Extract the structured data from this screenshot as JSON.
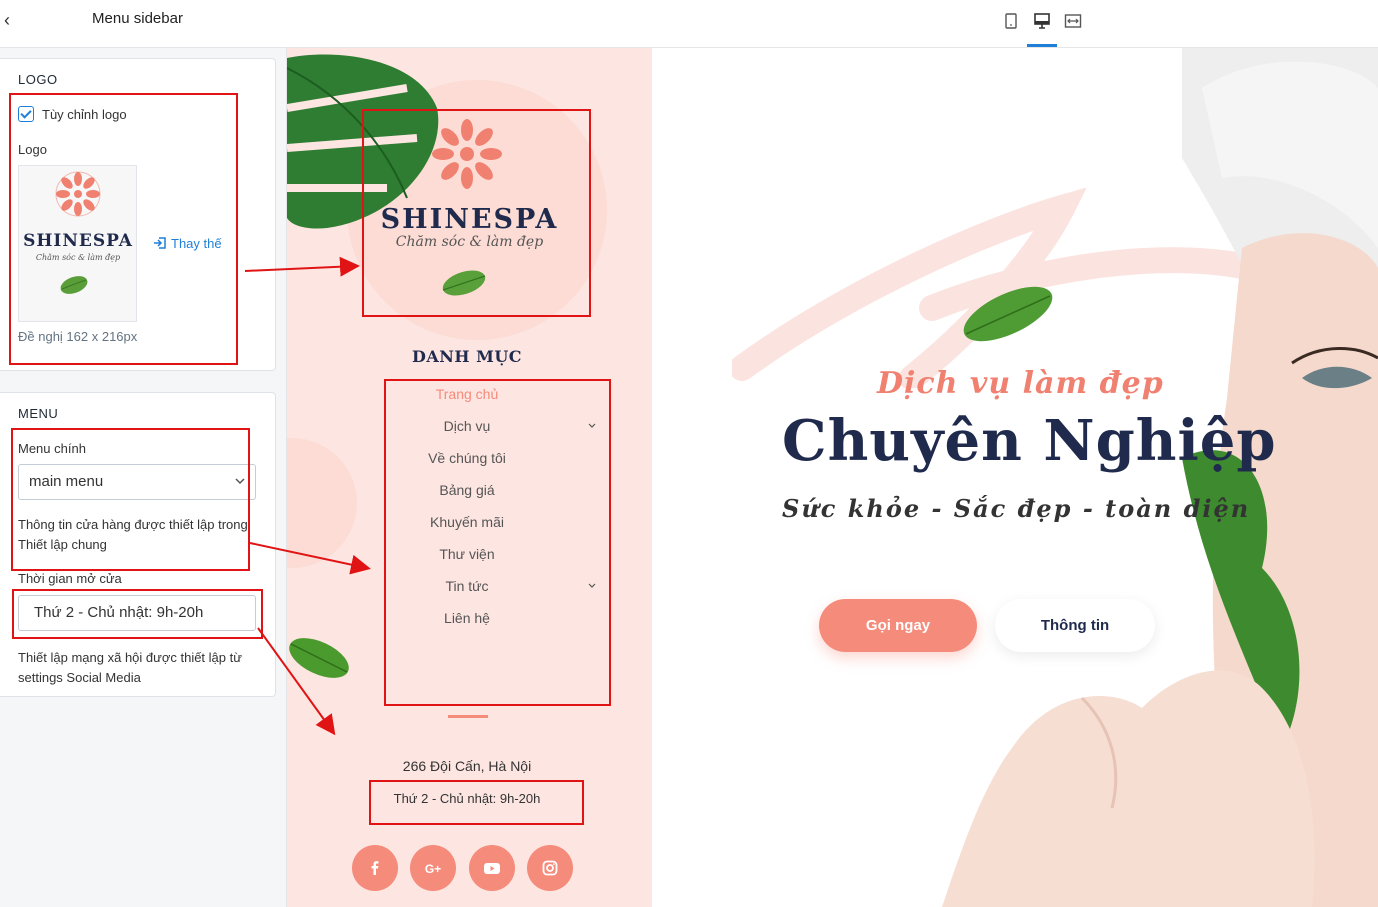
{
  "panel": {
    "title": "Menu sidebar",
    "logo_section": {
      "title": "LOGO",
      "custom_logo_label": "Tùy chỉnh logo",
      "custom_logo_checked": true,
      "logo_label": "Logo",
      "replace_label": "Thay thế",
      "size_hint": "Đề nghị 162 x 216px"
    },
    "menu_section": {
      "title": "MENU",
      "main_menu_label": "Menu chính",
      "main_menu_value": "main menu",
      "store_info_text": "Thông tin cửa hàng được thiết lập trong Thiết lập chung",
      "opening_hours_label": "Thời gian mở cửa",
      "opening_hours_value": "Thứ 2 - Chủ nhật: 9h-20h",
      "social_info_text": "Thiết lập mạng xã hội được thiết lập từ settings Social Media"
    }
  },
  "toolbar": {
    "icons": [
      "mobile-icon",
      "desktop-icon",
      "fullwidth-icon"
    ],
    "active": "desktop-icon"
  },
  "logo": {
    "brand": "SHINESPA",
    "tagline": "Chăm sóc & làm đẹp"
  },
  "preview_sidebar": {
    "heading": "DANH MỤC",
    "nav": [
      {
        "label": "Trang chủ",
        "active": true,
        "has_children": false
      },
      {
        "label": "Dịch vụ",
        "active": false,
        "has_children": true
      },
      {
        "label": "Về chúng tôi",
        "active": false,
        "has_children": false
      },
      {
        "label": "Bảng giá",
        "active": false,
        "has_children": false
      },
      {
        "label": "Khuyến mãi",
        "active": false,
        "has_children": false
      },
      {
        "label": "Thư viện",
        "active": false,
        "has_children": false
      },
      {
        "label": "Tin tức",
        "active": false,
        "has_children": true
      },
      {
        "label": "Liên hệ",
        "active": false,
        "has_children": false
      }
    ],
    "address": "266 Đội Cấn, Hà Nội",
    "hours": "Thứ 2 - Chủ nhật: 9h-20h",
    "social": [
      "facebook-icon",
      "google-plus-icon",
      "youtube-icon",
      "instagram-icon"
    ]
  },
  "hero": {
    "script_title": "Dịch vụ làm đẹp",
    "title": "Chuyên Nghiệp",
    "subtitle": "Sức khỏe - Sắc đẹp - toàn diện",
    "primary_button": "Gọi ngay",
    "secondary_button": "Thông tin"
  },
  "colors": {
    "accent": "#f58b7b",
    "navy": "#1f2a4d",
    "sidebar_bg": "#fde5e1",
    "annotation": "#e01414",
    "link": "#1f7fd8"
  }
}
